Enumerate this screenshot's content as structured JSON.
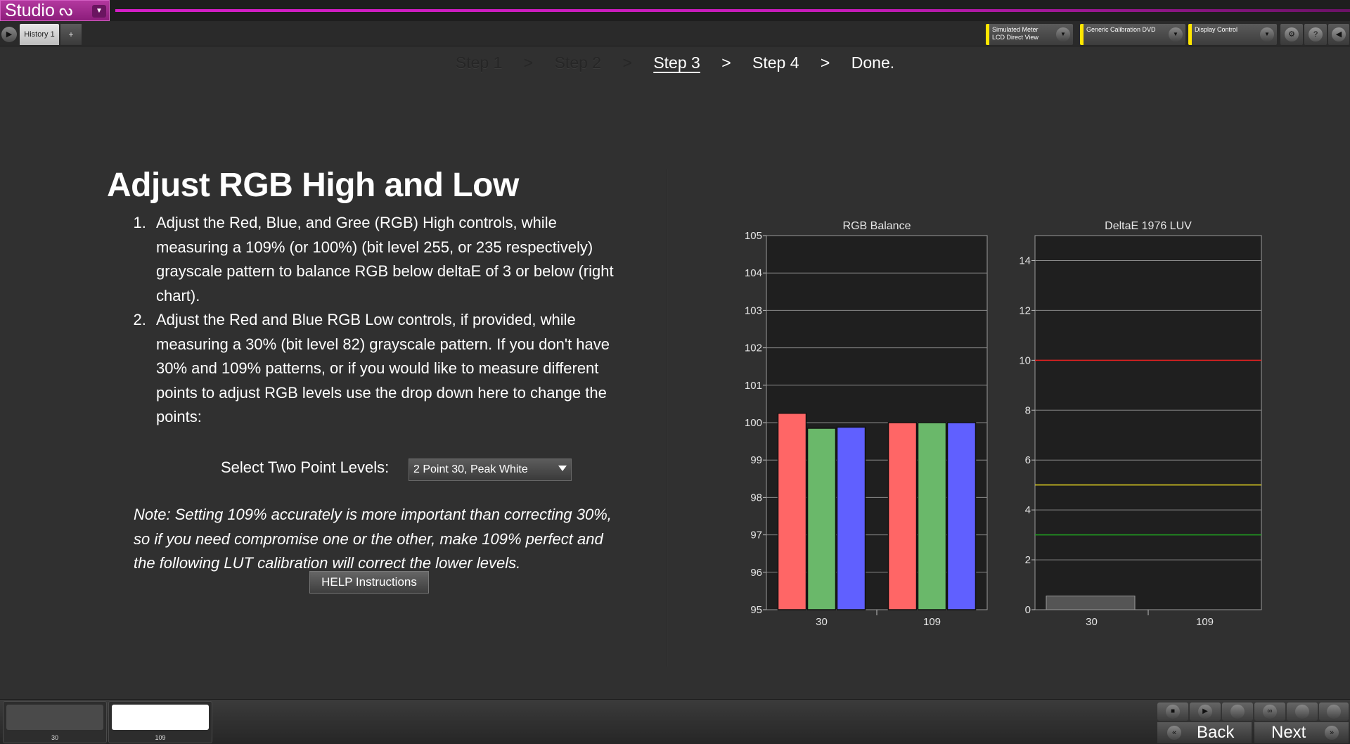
{
  "app": {
    "logo_text": "Studio",
    "tab_label": "History 1",
    "tab_add": "+",
    "meter_line1": "Simulated Meter",
    "meter_line2": "LCD Direct View",
    "source_label": "Generic Calibration DVD",
    "display_label": "Display Control"
  },
  "steps": [
    {
      "label": "Step 1",
      "state": "done"
    },
    {
      "label": "Step 2",
      "state": "done"
    },
    {
      "label": "Step 3",
      "state": "current"
    },
    {
      "label": "Step 4",
      "state": "next"
    },
    {
      "label": "Done.",
      "state": "next"
    }
  ],
  "step_sep": ">",
  "page": {
    "title": "Adjust RGB High and Low",
    "items": [
      "Adjust the Red, Blue, and Gree (RGB) High controls, while measuring a 109% (or 100%) (bit level 255, or 235 respectively) grayscale pattern to balance RGB below deltaE of 3 or below (right chart).",
      "Adjust the Red and Blue RGB Low controls, if provided, while measuring a 30% (bit level 82) grayscale pattern. If you don't have 30% and 109% patterns, or if you would like to measure different points to adjust RGB levels use the drop down here to change the points:"
    ],
    "select_label": "Select Two Point Levels:",
    "select_value": "2 Point 30, Peak White",
    "note": "Note: Setting 109% accurately is more important than correcting 30%, so if you need compromise one or the other, make 109% perfect and the following LUT calibration will correct the lower levels.",
    "help_button": "HELP Instructions"
  },
  "chart_data": [
    {
      "type": "bar",
      "title": "RGB Balance",
      "categories": [
        "30",
        "109"
      ],
      "series": [
        {
          "color": "#ff6666",
          "values": [
            100.25,
            100.0
          ]
        },
        {
          "color": "#6ab86a",
          "values": [
            99.85,
            100.0
          ]
        },
        {
          "color": "#6060ff",
          "values": [
            99.88,
            100.0
          ]
        }
      ],
      "ylim": [
        95,
        105
      ],
      "yticks": [
        95,
        96,
        97,
        98,
        99,
        100,
        101,
        102,
        103,
        104,
        105
      ],
      "grid": true
    },
    {
      "type": "bar",
      "title": "DeltaE 1976 LUV",
      "categories": [
        "30",
        "109"
      ],
      "values": [
        0.55,
        0
      ],
      "bar_color": "#555555",
      "ylim": [
        0,
        15
      ],
      "yticks": [
        0,
        2,
        4,
        6,
        8,
        10,
        12,
        14
      ],
      "reference_lines": [
        {
          "value": 10,
          "color": "#e02020"
        },
        {
          "value": 5,
          "color": "#e0d020"
        },
        {
          "value": 3,
          "color": "#20a020"
        }
      ],
      "grid": true
    }
  ],
  "bottom": {
    "thumbs": [
      {
        "label": "30",
        "color": "#4a4a4a"
      },
      {
        "label": "109",
        "color": "#ffffff"
      }
    ],
    "back_label": "Back",
    "next_label": "Next"
  }
}
